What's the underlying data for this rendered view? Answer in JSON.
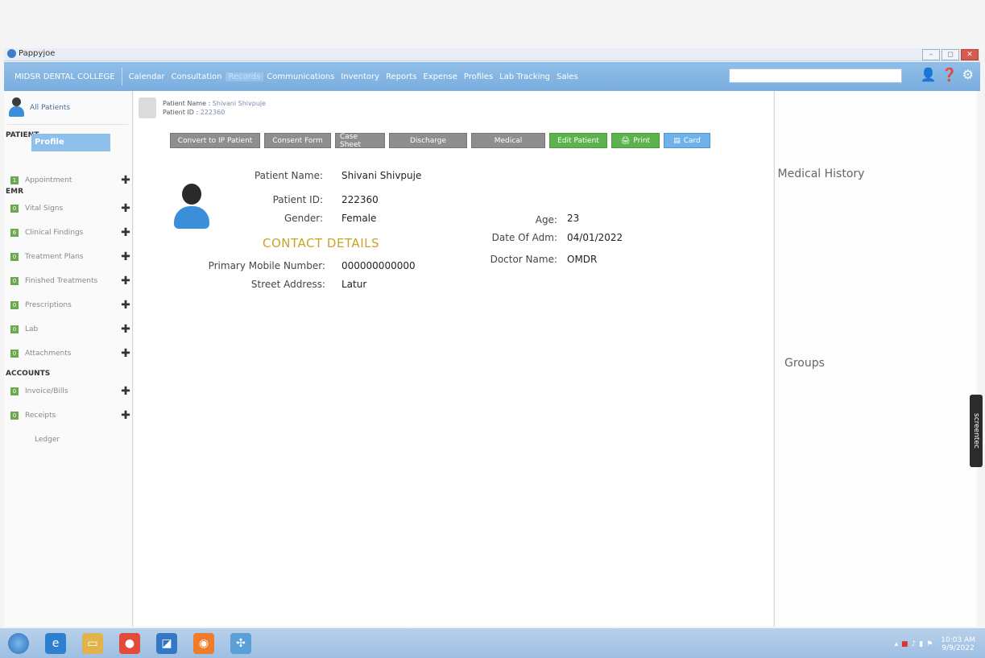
{
  "window": {
    "app_title": "Pappyjoe"
  },
  "nav": {
    "brand": "MIDSR DENTAL COLLEGE",
    "items": [
      {
        "label": "Calendar",
        "active": false
      },
      {
        "label": "Consultation",
        "active": false
      },
      {
        "label": "Records",
        "active": true
      },
      {
        "label": "Communications",
        "active": false
      },
      {
        "label": "Inventory",
        "active": false
      },
      {
        "label": "Reports",
        "active": false
      },
      {
        "label": "Expense",
        "active": false
      },
      {
        "label": "Profiles",
        "active": false
      },
      {
        "label": "Lab Tracking",
        "active": false
      },
      {
        "label": "Sales",
        "active": false
      }
    ]
  },
  "sidebar": {
    "all_patients": "All Patients",
    "section_patient": "PATIENT",
    "profile": "Profile",
    "section_emr": "EMR",
    "section_accounts": "ACCOUNTS",
    "items": [
      {
        "label": "Appointment",
        "badge": "1"
      },
      {
        "label": "Vital Signs",
        "badge": "0"
      },
      {
        "label": "Clinical Findings",
        "badge": "6"
      },
      {
        "label": "Treatment Plans",
        "badge": "0"
      },
      {
        "label": "Finished Treatments",
        "badge": "0"
      },
      {
        "label": "Prescriptions",
        "badge": "0"
      },
      {
        "label": "Lab",
        "badge": "0"
      },
      {
        "label": "Attachments",
        "badge": "0"
      },
      {
        "label": "Invoice/Bills",
        "badge": "0"
      },
      {
        "label": "Receipts",
        "badge": "0"
      }
    ],
    "ledger": "Ledger"
  },
  "header": {
    "name_label": "Patient Name :",
    "name_value": "Shivani Shivpuje",
    "id_label": "Patient ID :",
    "id_value": "222360"
  },
  "buttons": {
    "convert": "Convert to IP Patient",
    "consent": "Consent Form",
    "case_sheet": "Case Sheet",
    "discharge": "Discharge",
    "medical": "Medical",
    "edit": "Edit Patient",
    "print": "Print",
    "card": "Card"
  },
  "patient": {
    "name_label": "Patient Name:",
    "name": "Shivani Shivpuje",
    "id_label": "Patient ID:",
    "id": "222360",
    "gender_label": "Gender:",
    "gender": "Female",
    "age_label": "Age:",
    "age": "23",
    "adm_label": "Date Of Adm:",
    "adm": "04/01/2022",
    "doctor_label": "Doctor Name:",
    "doctor": "OMDR",
    "contact_head": "CONTACT DETAILS",
    "mobile_label": "Primary Mobile Number:",
    "mobile": "000000000000",
    "street_label": "Street Address:",
    "street": "Latur"
  },
  "right": {
    "medical_history": "Medical History",
    "groups": "Groups"
  },
  "overlay": {
    "screentec": "screentec"
  },
  "taskbar": {
    "time": "10:03 AM",
    "date": "9/9/2022"
  }
}
